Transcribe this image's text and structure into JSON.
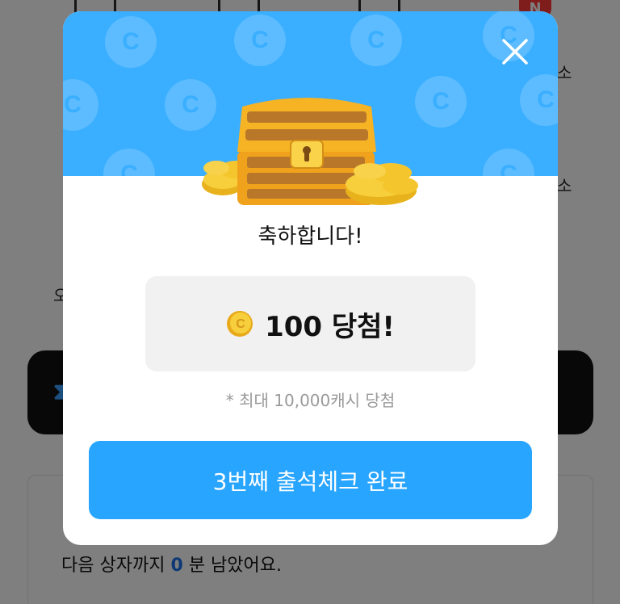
{
  "background": {
    "tab_badge": "N",
    "side_fragment_top": "소",
    "side_fragment_mid": "소",
    "left_fragment": "오",
    "next_box": {
      "prefix": "다음 상자까지",
      "minutes": "0",
      "suffix": "분 남았어요."
    }
  },
  "modal": {
    "congrats": "축하합니다!",
    "prize": {
      "amount_text": "100 당첨!"
    },
    "note": "* 최대 10,000캐시 당첨",
    "cta_label": "3번째 출석체크 완료",
    "coin_letter": "C"
  },
  "colors": {
    "hero_blue": "#3aaeff",
    "cta_blue": "#28a5ff",
    "coin_gold": "#f7c52a",
    "chest_orange": "#f0a21c",
    "accent": "#1a73e8"
  },
  "icons": {
    "close": "close-icon",
    "chest": "treasure-chest-icon",
    "coin": "coin-icon"
  }
}
